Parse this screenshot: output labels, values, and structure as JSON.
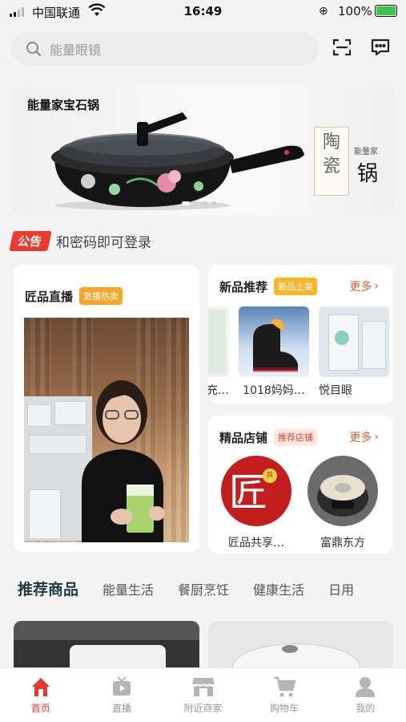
{
  "status_bar": {
    "carrier": "中国联通",
    "time": "16:49",
    "battery": "100%"
  },
  "search": {
    "placeholder": "能量眼镜"
  },
  "icons": {
    "scan": "scan-icon",
    "message": "message-icon"
  },
  "banner": {
    "title": "能量家宝石锅",
    "tag_chars": "陶\n瓷",
    "tag_brand": "能量家",
    "tag_big": "锅",
    "slide_count": 4,
    "active_slide": 1
  },
  "notice": {
    "badge": "公告",
    "text": "和密码即可登录"
  },
  "live_card": {
    "title": "匠品直播",
    "badge": "直播热卖"
  },
  "new_card": {
    "title": "新品推荐",
    "badge": "新品上架",
    "more": "更多",
    "items": [
      {
        "caption": "…充…"
      },
      {
        "caption": "1018妈妈…"
      },
      {
        "caption": "悦目眼"
      }
    ]
  },
  "store_card": {
    "title": "精品店铺",
    "badge": "推荐店铺",
    "more": "更多",
    "stores": [
      {
        "name": "匠品共享…",
        "logo_text": "匠"
      },
      {
        "name": "富鼎东方"
      }
    ]
  },
  "category_tabs": [
    "推荐商品",
    "能量生活",
    "餐厨烹饪",
    "健康生活",
    "日用"
  ],
  "active_tab": 0,
  "bottom_nav": [
    {
      "label": "首页",
      "icon": "home-icon",
      "active": true
    },
    {
      "label": "直播",
      "icon": "tv-icon",
      "active": false
    },
    {
      "label": "附近商家",
      "icon": "store-icon",
      "active": false
    },
    {
      "label": "购物车",
      "icon": "cart-icon",
      "active": false
    },
    {
      "label": "我的",
      "icon": "user-icon",
      "active": false
    }
  ],
  "colors": {
    "accent": "#e8372c",
    "badge_orange": "#f4a62a",
    "more": "#e85b3a",
    "battery": "#3dc34a"
  }
}
